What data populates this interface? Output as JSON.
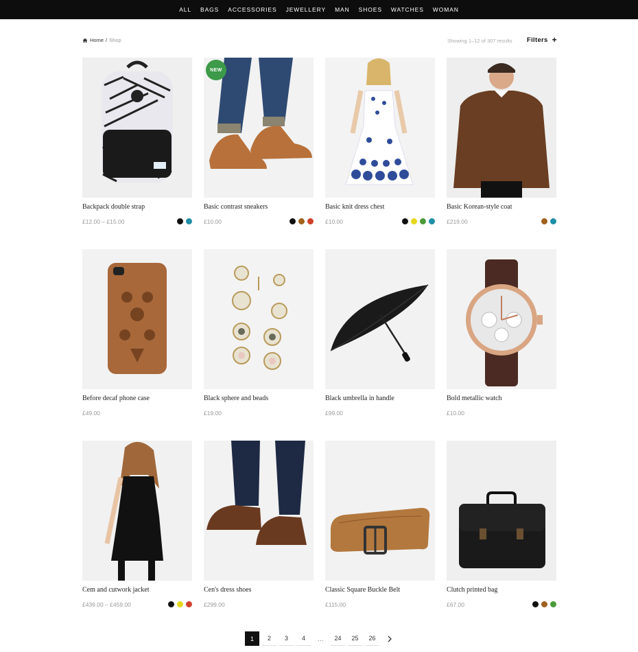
{
  "nav": [
    "ALL",
    "BAGS",
    "ACCESSORIES",
    "JEWELLERY",
    "MAN",
    "SHOES",
    "WATCHES",
    "WOMAN"
  ],
  "breadcrumb": {
    "home": "Home",
    "sep": "/",
    "current": "Shop"
  },
  "results": "Showing 1–12 of 307 results",
  "filters": {
    "label": "Filters",
    "icon": "+"
  },
  "badge": "NEW",
  "products": [
    {
      "name": "Backpack double strap",
      "price": "£12.00 – £15.00",
      "swatches": [
        "#111111",
        "#1e8fa6"
      ]
    },
    {
      "name": "Basic contrast sneakers",
      "price": "£10.00",
      "swatches": [
        "#111111",
        "#a0601e",
        "#d0402a"
      ]
    },
    {
      "name": "Basic knit dress chest",
      "price": "£10.00",
      "swatches": [
        "#111111",
        "#e6d81e",
        "#4a9a3a",
        "#1e8fa6"
      ]
    },
    {
      "name": "Basic Korean-style coat",
      "price": "£219.00",
      "swatches": [
        "#a0601e",
        "#1e8fa6"
      ]
    },
    {
      "name": "Before decaf phone case",
      "price": "£49.00",
      "swatches": []
    },
    {
      "name": "Black sphere and beads",
      "price": "£19.00",
      "swatches": []
    },
    {
      "name": "Black umbrella in handle",
      "price": "£99.00",
      "swatches": []
    },
    {
      "name": "Bold metallic watch",
      "price": "£10.00",
      "swatches": []
    },
    {
      "name": "Cem and cutwork jacket",
      "price": "£439.00 – £459.00",
      "swatches": [
        "#111111",
        "#e6d81e",
        "#d0402a"
      ]
    },
    {
      "name": "Cen's dress shoes",
      "price": "£299.00",
      "swatches": []
    },
    {
      "name": "Classic Square Buckle Belt",
      "price": "£115.00",
      "swatches": []
    },
    {
      "name": "Clutch printed bag",
      "price": "£67.00",
      "swatches": [
        "#111111",
        "#a0601e",
        "#4a9a3a"
      ]
    }
  ],
  "pagination": [
    "1",
    "2",
    "3",
    "4",
    "…",
    "24",
    "25",
    "26"
  ],
  "pagination_active": "1"
}
